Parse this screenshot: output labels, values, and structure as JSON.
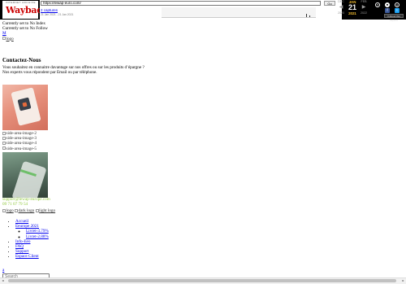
{
  "wayback": {
    "logo_tiny": "INTERNET ARCHIVE",
    "logo_big": "WaybackMachine",
    "url": "https://lewap-euro.com/",
    "go_label": "Go",
    "captures": "2 captures",
    "date_range": "21 Jan 2021 - 21 Jan 2021",
    "prev_month": "DEC",
    "current_month": "JAN",
    "next_month": "FEB",
    "prev_day": "◀",
    "current_day": "21",
    "next_day": "▶",
    "prev_year": "2020",
    "current_year": "2021",
    "next_year": "2022",
    "about_label": "▾ About this capture",
    "accent_color": "#f8c030",
    "icons": [
      "help-icon",
      "user-icon",
      "facebook-icon",
      "twitter-icon"
    ]
  },
  "page": {
    "noindex": "Currently set to No Index",
    "nofollow": "Currently set to No Follow",
    "m_link": "M",
    "logo_alt": "logo",
    "contact_heading": "Contactez-Nous",
    "contact_text_1": "Vous souhaitez en connaitre davantage sur nos offres ou sur les produits d’épargne ?",
    "contact_text_2": "Nos experts vous répondent par Email ou par téléphone.",
    "side_images": [
      "side-area-image-2",
      "side-area-image-3",
      "side-area-image-4",
      "side-area-image-5"
    ],
    "email": "support@lewap-europe.com",
    "phone": "09 71 07 79 54",
    "logo_alts": [
      "logo",
      "dark logo",
      "light logo"
    ],
    "menu": {
      "accueil": "Accueil",
      "eeurope": "Eeurope 2021",
      "sub": [
        "Livret-3.79%",
        "Livret-2.88%"
      ],
      "rest": [
        "Info-Eeo",
        "FAQ",
        "Support",
        "Espace Client"
      ]
    },
    "small_link": "a",
    "search_placeholder": "Search"
  }
}
